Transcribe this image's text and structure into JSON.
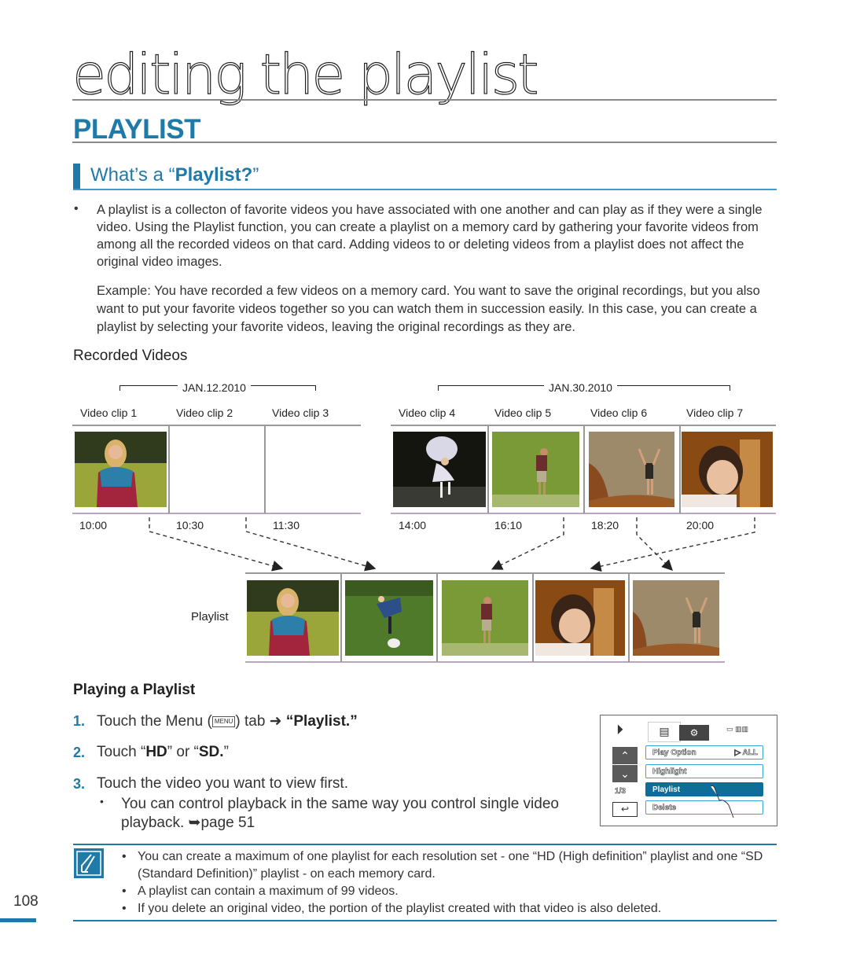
{
  "page": {
    "title": "editing the playlist",
    "section": "PLAYLIST",
    "page_number": "108",
    "accent_color": "#1f7aa8"
  },
  "intro": {
    "subtitle_prefix": "What’s a “",
    "subtitle_bold": "Playlist?",
    "subtitle_suffix": "”",
    "bullet": "A playlist is a collecton of favorite videos you have associated with one another and can play as if they were a single video. Using the Playlist function, you can create a playlist on a memory card by gathering your favorite videos from among all the recorded videos on that card. Adding videos to or deleting videos from a playlist does not affect the original video images.",
    "example": "Example: You have recorded a few videos on a memory card. You want to save the original recordings, but you also want to put your favorite videos together so you can watch them in succession easily. In this case, you can create a playlist by selecting your favorite videos, leaving the original recordings as they are."
  },
  "recorded": {
    "heading": "Recorded Videos",
    "groups": [
      {
        "date": "JAN.12.2010"
      },
      {
        "date": "JAN.30.2010"
      }
    ],
    "clips": [
      {
        "label": "Video clip 1",
        "time": "10:00",
        "image": "woman-jogging"
      },
      {
        "label": "Video clip 2",
        "time": "10:30",
        "image": "blank"
      },
      {
        "label": "Video clip 3",
        "time": "11:30",
        "image": "blank"
      },
      {
        "label": "Video clip 4",
        "time": "14:00",
        "image": "girl-with-umbrella"
      },
      {
        "label": "Video clip 5",
        "time": "16:10",
        "image": "golfer"
      },
      {
        "label": "Video clip 6",
        "time": "18:20",
        "image": "hiker-on-rock"
      },
      {
        "label": "Video clip 7",
        "time": "20:00",
        "image": "smiling-woman"
      }
    ],
    "playlist_label": "Playlist",
    "playlist_items": [
      "woman-jogging",
      "man-with-dog",
      "golfer",
      "smiling-woman",
      "hiker-on-rock"
    ]
  },
  "playing": {
    "heading": "Playing a Playlist",
    "steps": [
      {
        "num": "1.",
        "pre": "Touch the Menu (",
        "key": "MENU",
        "mid": ") tab ➜ ",
        "bold": "“Playlist.”"
      },
      {
        "num": "2.",
        "pre": "Touch “",
        "bold1": "HD",
        "mid": "” or “",
        "bold2": "SD.",
        "post": "”"
      },
      {
        "num": "3.",
        "text": "Touch the video you want to view first."
      }
    ],
    "sub_bullet": "You can control playback in the same way you control single video playback. ➥page 51"
  },
  "camera_screen": {
    "page_indicator": "1/3",
    "items": [
      {
        "label": "Play Option",
        "value": "▷ ALL",
        "selected": false
      },
      {
        "label": "Highlight",
        "selected": false
      },
      {
        "label": "Playlist",
        "selected": true
      },
      {
        "label": "Delete",
        "selected": false
      }
    ]
  },
  "notes": [
    "You can create a maximum of one playlist for each resolution set - one “HD (High definition” playlist and one “SD (Standard Definition)” playlist - on each memory card.",
    "A playlist can contain a maximum of 99 videos.",
    "If you delete an original video, the portion of the playlist created with that video is also deleted."
  ]
}
